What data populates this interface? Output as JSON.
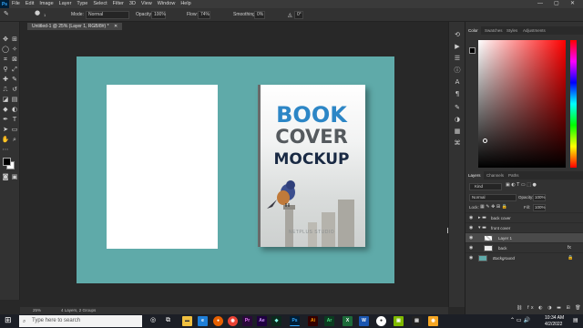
{
  "menubar": {
    "logo": "Ps",
    "items": [
      "File",
      "Edit",
      "Image",
      "Layer",
      "Type",
      "Select",
      "Filter",
      "3D",
      "View",
      "Window",
      "Help"
    ],
    "minimize": "—",
    "maximize": "▢",
    "close": "✕"
  },
  "options": {
    "brush_size": "1",
    "mode_label": "Mode:",
    "mode_value": "Normal",
    "opacity_label": "Opacity:",
    "opacity_value": "100%",
    "flow_label": "Flow:",
    "flow_value": "74%",
    "smoothing_label": "Smoothing:",
    "smoothing_value": "0%",
    "angle_value": "0°"
  },
  "document": {
    "tab_title": "Untitled-1 @ 25% (Layer 1, RGB/8#) *",
    "tab_close": "✕"
  },
  "cover": {
    "line1": "BOOK",
    "line2": "COVER",
    "line3": "MOCKUP",
    "publisher": "NETPLUS STUDIO"
  },
  "status": {
    "zoom": "25%",
    "info": "4 Layers, 2 Groups"
  },
  "color_panel": {
    "tabs": [
      "Color",
      "Swatches",
      "Styles",
      "Adjustments"
    ]
  },
  "layers_panel": {
    "tabs": [
      "Layers",
      "Channels",
      "Paths"
    ],
    "filter_kind": "Kind",
    "blend_mode": "Normal",
    "opacity_label": "Opacity:",
    "opacity_value": "100%",
    "lock_label": "Lock:",
    "fill_label": "Fill:",
    "fill_value": "100%",
    "layers": [
      {
        "name": "back cover"
      },
      {
        "name": "front cover"
      },
      {
        "name": "Layer 1"
      },
      {
        "name": "back"
      },
      {
        "name": "Background"
      }
    ]
  },
  "taskbar": {
    "search_placeholder": "Type here to search",
    "time": "10:34 AM",
    "date": "4/2/2022",
    "apps": [
      "Pr",
      "Ae",
      "Ps",
      "Ai",
      "Ar"
    ]
  },
  "colors": {
    "canvas_bg": "#5faaa9",
    "accent_blue": "#2c86c6",
    "ps_blue": "#31a8ff"
  }
}
